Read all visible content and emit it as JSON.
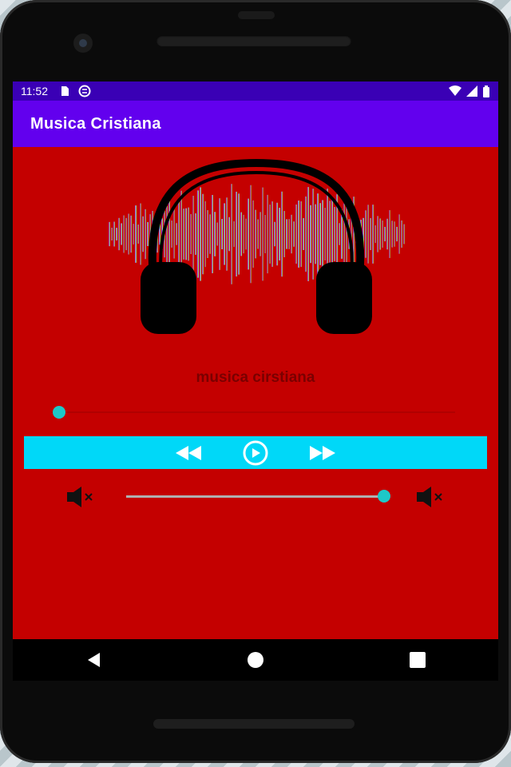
{
  "status_bar": {
    "time": "11:52",
    "left_icons": [
      "sd-card-icon",
      "sync-icon"
    ],
    "right_icons": [
      "wifi-icon",
      "signal-icon",
      "battery-icon"
    ]
  },
  "app_bar": {
    "title": "Musica Cristiana"
  },
  "player": {
    "track_title": "musica cirstiana",
    "seek_progress": 0.02,
    "controls": [
      "rewind-icon",
      "play-icon",
      "fast-forward-icon"
    ],
    "volume_level": 0.98
  },
  "nav": [
    "back-icon",
    "home-icon",
    "recents-icon"
  ],
  "colors": {
    "screen_bg": "#c40000",
    "app_bar": "#6200ee",
    "status_bar": "#3a00b5",
    "controls_bg": "#00d8f8",
    "accent": "#1ec8c8"
  }
}
